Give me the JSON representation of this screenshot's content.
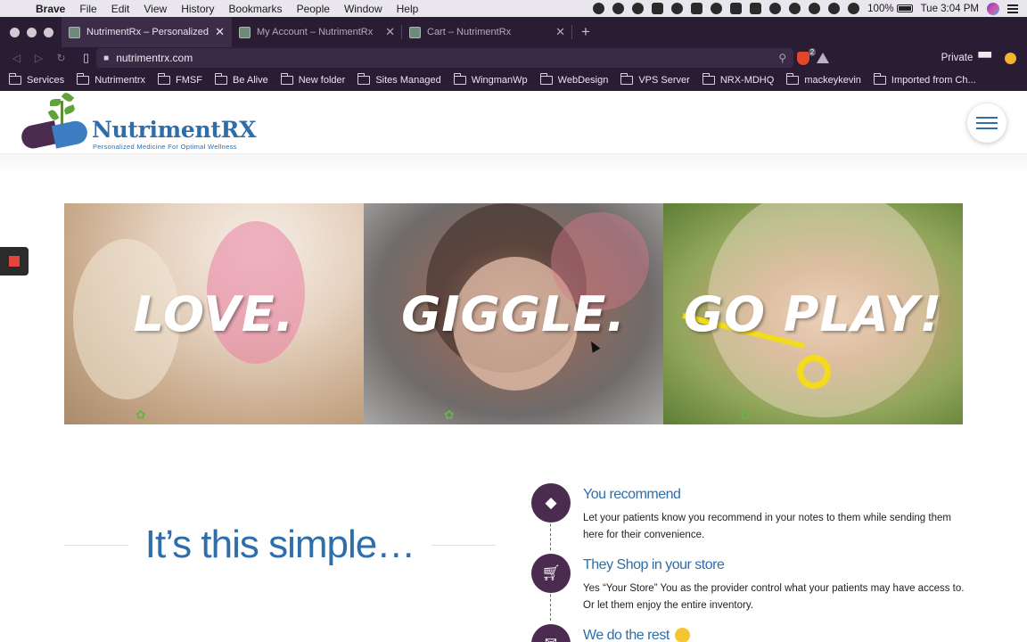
{
  "os_menubar": {
    "app_name": "Brave",
    "menus": [
      "File",
      "Edit",
      "View",
      "History",
      "Bookmarks",
      "People",
      "Window",
      "Help"
    ],
    "battery": "100%",
    "clock": "Tue 3:04 PM"
  },
  "browser": {
    "tabs": [
      {
        "label": "NutrimentRx – Personalized Med",
        "active": true
      },
      {
        "label": "My Account – NutrimentRx",
        "active": false
      },
      {
        "label": "Cart – NutrimentRx",
        "active": false
      }
    ],
    "new_tab": "+",
    "url": "nutrimentrx.com",
    "shield_count": "2",
    "private_label": "Private",
    "bookmarks": [
      "Services",
      "Nutrimentrx",
      "FMSF",
      "Be Alive",
      "New folder",
      "Sites Managed",
      "WingmanWp",
      "WebDesign",
      "VPS Server",
      "NRX-MDHQ",
      "mackeykevin",
      "Imported from Ch..."
    ]
  },
  "site": {
    "logo": {
      "brand": "NutrimentRX",
      "tagline": "Personalized Medicine For Optimal Wellness"
    },
    "hero": {
      "panels": [
        "LOVE.",
        "GIGGLE.",
        "GO PLAY!"
      ]
    },
    "intro_title": "It’s this simple…",
    "steps": [
      {
        "title": "You recommend",
        "description": "Let your patients know you recommend in your notes to them while sending them here for their convenience.",
        "icon": "diamond-icon"
      },
      {
        "title": "They Shop in your store",
        "description": "Yes “Your Store” You as the provider control what your patients may have access to. Or let them enjoy the entire inventory.",
        "icon": "cart-icon"
      },
      {
        "title": "We do the rest",
        "description": "",
        "icon": "envelope-icon"
      }
    ]
  },
  "colors": {
    "brand_blue": "#2f6ea9",
    "brand_purple": "#4b2b4f",
    "browser_chrome": "#2a1d33"
  }
}
